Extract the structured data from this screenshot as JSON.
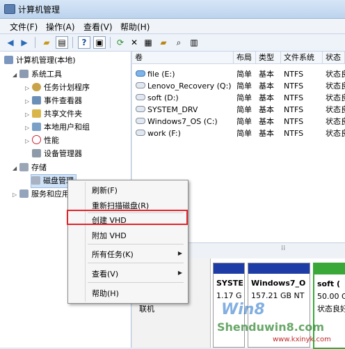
{
  "window": {
    "title": "计算机管理"
  },
  "menu": [
    "文件(F)",
    "操作(A)",
    "查看(V)",
    "帮助(H)"
  ],
  "toolbar": {
    "icons": [
      "back-icon",
      "forward-icon",
      "up-folder-icon",
      "show-hide-tree-icon",
      "help-icon",
      "console-icon",
      "refresh-icon",
      "delete-icon",
      "properties-icon",
      "open-icon",
      "find-icon",
      "view-icon"
    ]
  },
  "tree": {
    "root": "计算机管理(本地)",
    "system_tools": "系统工具",
    "items_system": [
      "任务计划程序",
      "事件查看器",
      "共享文件夹",
      "本地用户和组",
      "性能",
      "设备管理器"
    ],
    "storage": "存储",
    "disk_mgmt": "磁盘管理",
    "services": "服务和应用程序"
  },
  "volumes": {
    "columns": [
      "卷",
      "布局",
      "类型",
      "文件系统",
      "状态"
    ],
    "rows": [
      {
        "name": "file (E:)",
        "layout": "简单",
        "type": "基本",
        "fs": "NTFS",
        "status": "状态良"
      },
      {
        "name": "Lenovo_Recovery (Q:)",
        "layout": "简单",
        "type": "基本",
        "fs": "NTFS",
        "status": "状态良"
      },
      {
        "name": "soft (D:)",
        "layout": "简单",
        "type": "基本",
        "fs": "NTFS",
        "status": "状态良"
      },
      {
        "name": "SYSTEM_DRV",
        "layout": "简单",
        "type": "基本",
        "fs": "NTFS",
        "status": "状态良"
      },
      {
        "name": "Windows7_OS (C:)",
        "layout": "简单",
        "type": "基本",
        "fs": "NTFS",
        "status": "状态良"
      },
      {
        "name": "work (F:)",
        "layout": "简单",
        "type": "基本",
        "fs": "NTFS",
        "status": "状态良"
      }
    ]
  },
  "graph": {
    "disk_label": "联机",
    "partitions": [
      {
        "name": "SYSTE",
        "size": "1.17 G"
      },
      {
        "name": "Windows7_O",
        "size": "157.21 GB NT"
      },
      {
        "name": "soft (",
        "size": "50.00 G",
        "status": "状态良好"
      }
    ]
  },
  "context_menu": {
    "items": [
      "刷新(F)",
      "重新扫描磁盘(R)",
      "创建 VHD",
      "附加 VHD",
      "所有任务(K)",
      "查看(V)",
      "帮助(H)"
    ]
  },
  "watermark": {
    "text": "Shenduwin8.com",
    "url": "www.kxinyk.com",
    "logo": "Win8"
  },
  "colors": {
    "accent": "#1d3ca6",
    "highlight_border": "#e0242a",
    "primary_partition": "#3aa838"
  }
}
